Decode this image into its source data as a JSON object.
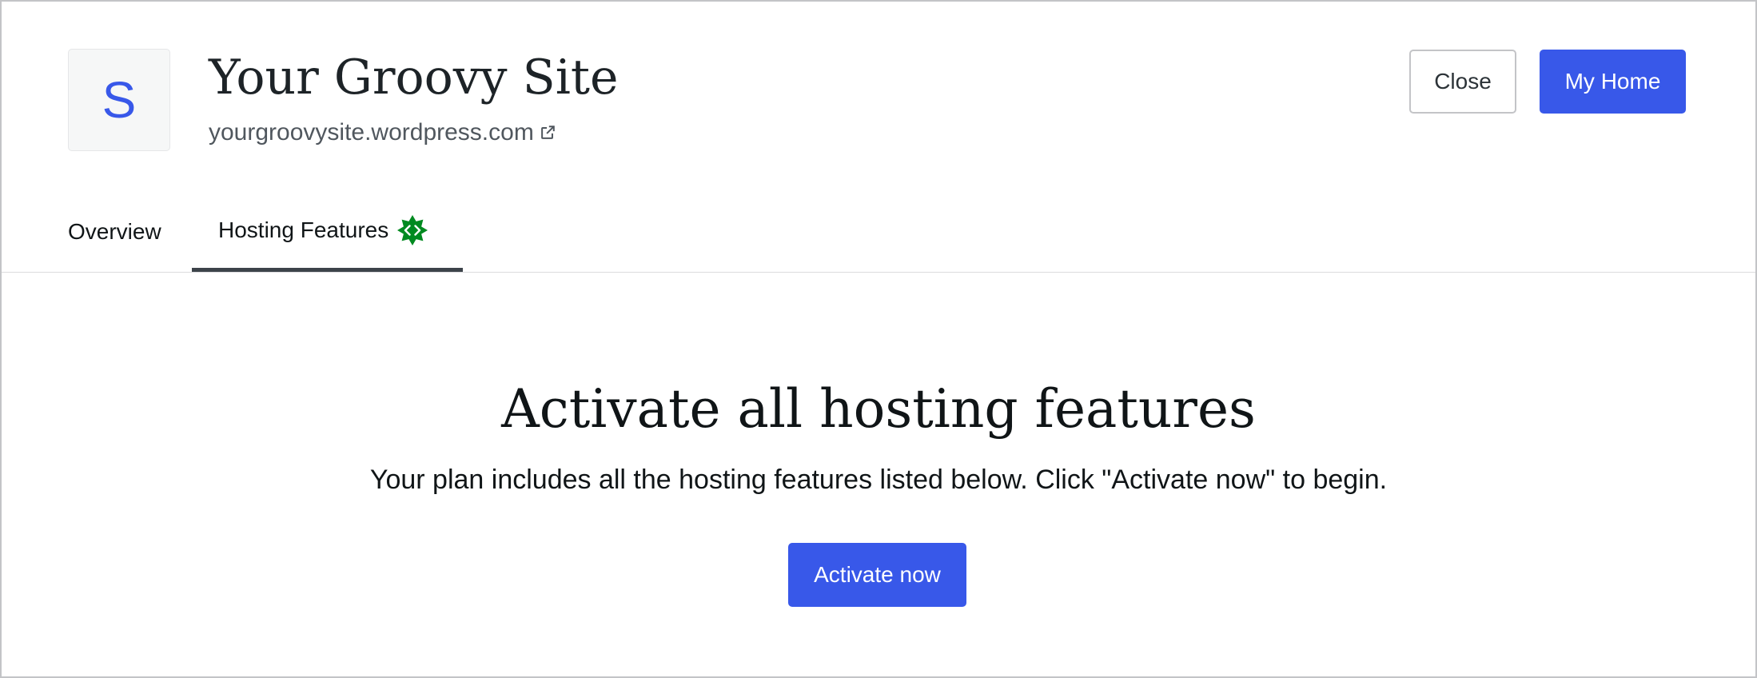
{
  "header": {
    "site_icon_letter": "S",
    "site_title": "Your Groovy Site",
    "site_url": "yourgroovysite.wordpress.com",
    "close_label": "Close",
    "home_label": "My Home"
  },
  "tabs": [
    {
      "label": "Overview",
      "selected": false
    },
    {
      "label": "Hosting Features",
      "selected": true,
      "badge_icon": "code-badge-icon"
    }
  ],
  "main": {
    "title": "Activate all hosting features",
    "description": "Your plan includes all the hosting features listed below. Click \"Activate now\" to begin.",
    "activate_label": "Activate now"
  },
  "colors": {
    "accent": "#3858e9",
    "badge": "#008a20",
    "tab_indicator": "#3c434a"
  }
}
